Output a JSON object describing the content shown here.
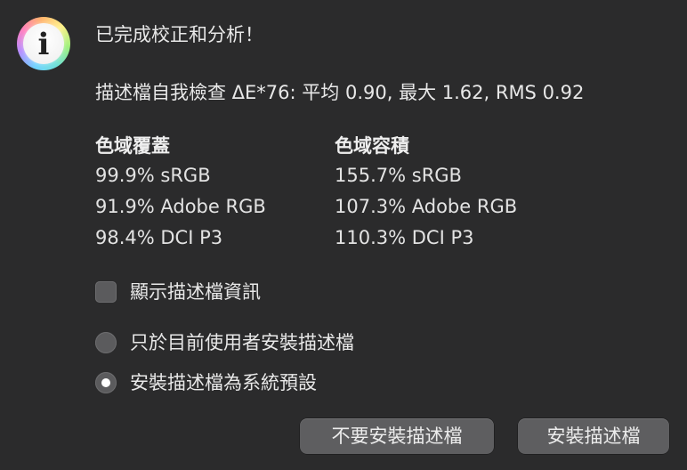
{
  "dialog": {
    "icon": "info-icon",
    "title": "已完成校正和分析！",
    "self_test": "描述檔自我檢查 ΔE*76: 平均 0.90, 最大 1.62, RMS 0.92",
    "gamut_coverage": {
      "heading": "色域覆蓋",
      "rows": [
        "99.9% sRGB",
        "91.9% Adobe RGB",
        "98.4% DCI P3"
      ]
    },
    "gamut_volume": {
      "heading": "色域容積",
      "rows": [
        "155.7% sRGB",
        "107.3% Adobe RGB",
        "110.3% DCI P3"
      ]
    },
    "show_profile_info": {
      "label": "顯示描述檔資訊",
      "checked": false
    },
    "install_options": [
      {
        "label": "只於目前使用者安裝描述檔",
        "selected": false
      },
      {
        "label": "安裝描述檔為系統預設",
        "selected": true
      }
    ],
    "buttons": {
      "dont_install": "不要安裝描述檔",
      "install": "安裝描述檔"
    }
  }
}
